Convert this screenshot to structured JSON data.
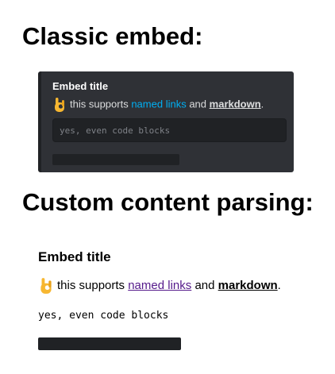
{
  "classic": {
    "heading": "Classic embed:",
    "embed": {
      "title": "Embed title",
      "emoji_icon": "ok-hand-icon",
      "desc_prefix": "this supports",
      "link_text": "named links",
      "desc_middle": "and",
      "bold_text": "markdown",
      "desc_suffix": ".",
      "code": "yes, even code blocks"
    },
    "colors": {
      "embed_bg": "#2f3136",
      "link": "#00b0f4"
    }
  },
  "custom": {
    "heading": "Custom content parsing:",
    "embed": {
      "title": "Embed title",
      "emoji_icon": "ok-hand-icon",
      "desc_prefix": "this supports",
      "link_text": "named links",
      "desc_middle": "and",
      "bold_text": "markdown",
      "desc_suffix": ".",
      "code": "yes, even code blocks"
    },
    "colors": {
      "link": "#551a8b"
    }
  }
}
